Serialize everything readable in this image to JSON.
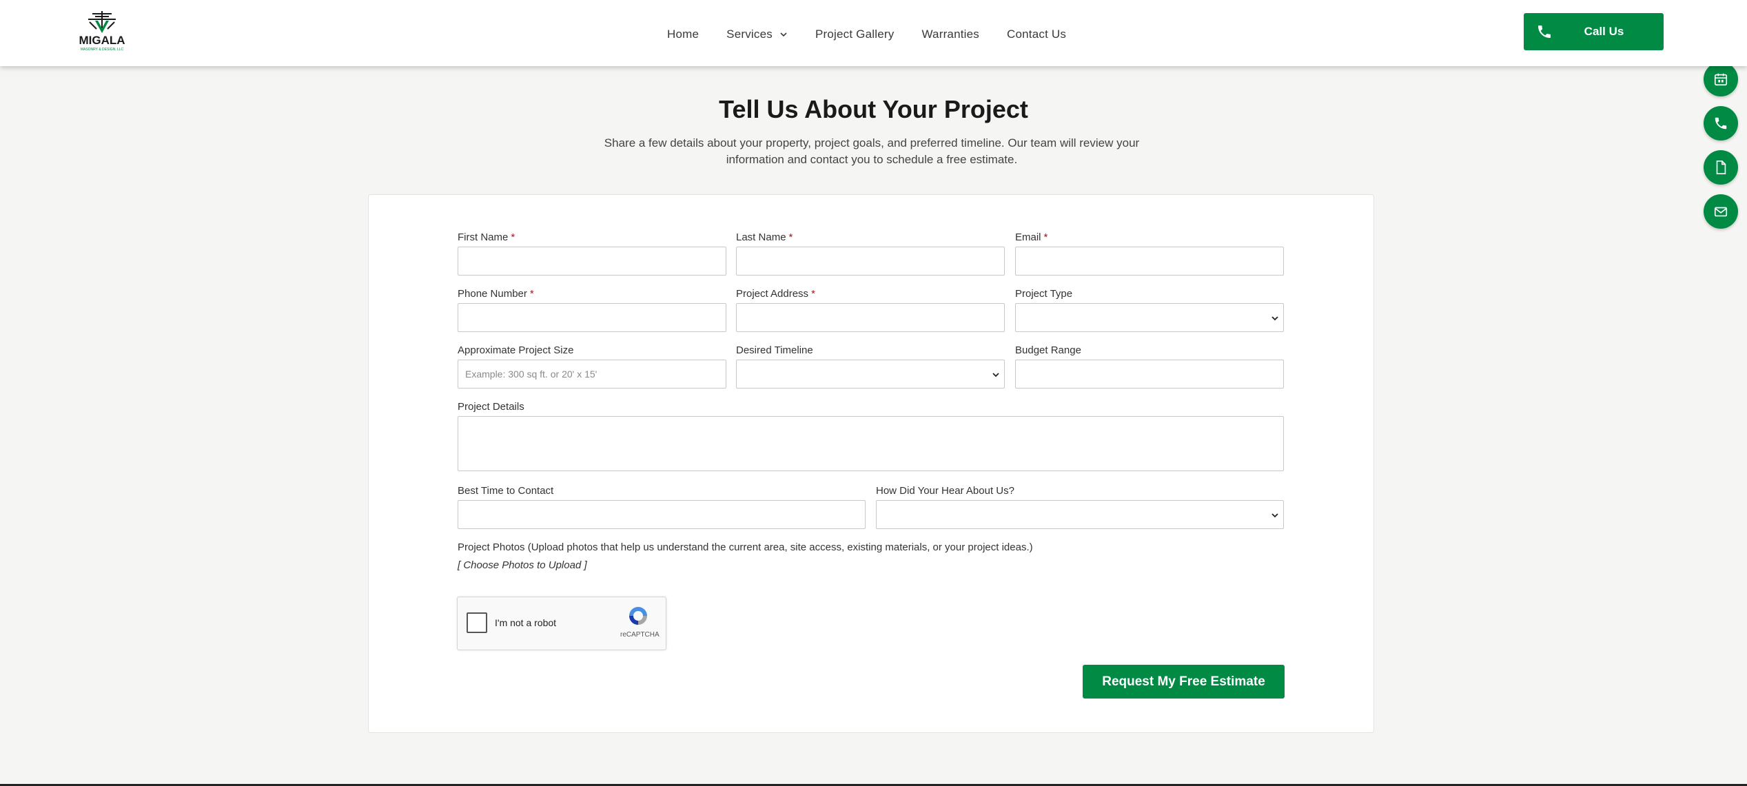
{
  "brand": {
    "logo_text": "MIGALA",
    "logo_subtext": "MASONRY & DESIGN, LLC",
    "accent_color": "#008a43"
  },
  "nav": {
    "items": [
      {
        "label": "Home"
      },
      {
        "label": "Services",
        "has_dropdown": true
      },
      {
        "label": "Project Gallery"
      },
      {
        "label": "Warranties"
      },
      {
        "label": "Contact Us"
      }
    ],
    "call_label": "Call Us"
  },
  "side_actions": [
    {
      "icon": "user-icon",
      "color": "#757575"
    },
    {
      "icon": "calendar-icon",
      "color": "#008a43"
    },
    {
      "icon": "phone-icon",
      "color": "#008a43"
    },
    {
      "icon": "document-icon",
      "color": "#008a43"
    },
    {
      "icon": "mail-icon",
      "color": "#008a43"
    }
  ],
  "page": {
    "title": "Tell Us About Your Project",
    "subtitle_line1": "Share a few details about your property, project goals, and preferred timeline. Our team will review your",
    "subtitle_line2": "information and contact you to schedule a free estimate."
  },
  "form": {
    "first_name": {
      "label": "First Name",
      "required": "*",
      "value": ""
    },
    "last_name": {
      "label": "Last Name",
      "required": "*",
      "value": ""
    },
    "email": {
      "label": "Email",
      "required": "*",
      "value": ""
    },
    "phone": {
      "label": "Phone Number",
      "required": "*",
      "value": ""
    },
    "address": {
      "label": "Project Address",
      "required": "*",
      "value": ""
    },
    "project_type": {
      "label": "Project Type",
      "value": ""
    },
    "project_size": {
      "label": "Approximate Project Size",
      "placeholder": "Example: 300 sq ft. or 20' x 15'",
      "value": ""
    },
    "timeline": {
      "label": "Desired Timeline",
      "value": ""
    },
    "budget": {
      "label": "Budget Range",
      "value": ""
    },
    "details": {
      "label": "Project Details",
      "value": ""
    },
    "best_time": {
      "label": "Best Time to Contact",
      "value": ""
    },
    "hear_about": {
      "label": "How Did Your Hear About Us?",
      "value": ""
    },
    "photos": {
      "label": "Project Photos (Upload photos that help us understand the current area, site access, existing materials, or your project ideas.)",
      "link": "[ Choose Photos to Upload ]"
    },
    "captcha": {
      "label": "I'm not a robot",
      "brand": "reCAPTCHA"
    },
    "submit_label": "Request My Free Estimate"
  }
}
